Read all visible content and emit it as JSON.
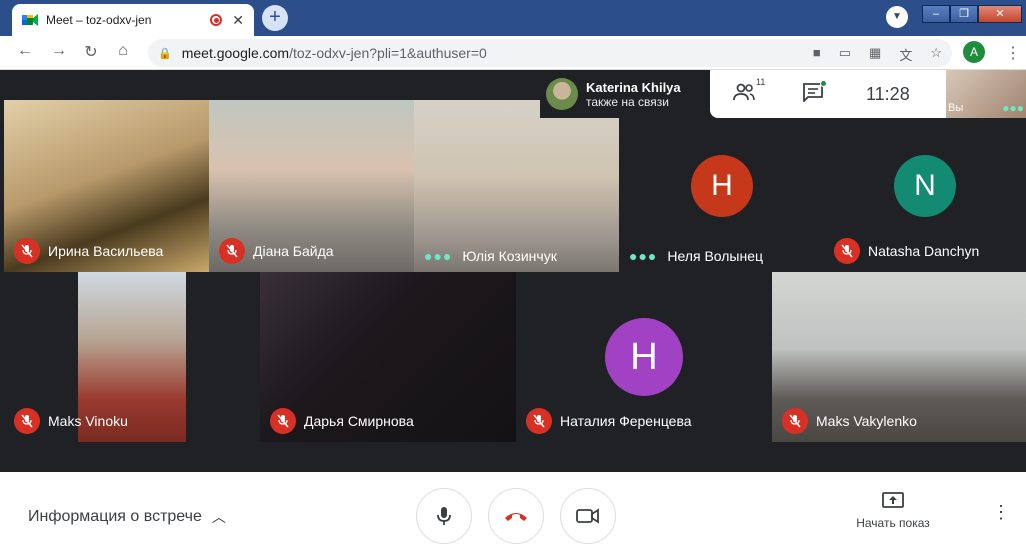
{
  "browser": {
    "tab_title": "Meet – toz-odxv-jen",
    "url_host": "meet.google.com",
    "url_path": "/toz-odxv-jen?pli=1&authuser=0",
    "profile_initial": "A"
  },
  "call_info": {
    "presenter_name": "Katerina Khilya",
    "presenter_status": "также на связи",
    "participants_count": "11",
    "time": "11:28",
    "self_label": "Вы"
  },
  "tiles": [
    {
      "name": "Ирина Васильева",
      "muted": true
    },
    {
      "name": "Діана Байда",
      "muted": true
    },
    {
      "name": "Юлія Козинчук",
      "muted": false
    },
    {
      "name": "Неля Волынец",
      "muted": false,
      "initial": "H",
      "color": "#c5381a"
    },
    {
      "name": "Natasha Danchyn",
      "muted": true,
      "initial": "N",
      "color": "#138a72"
    },
    {
      "name": "Maks Vinoku",
      "muted": true
    },
    {
      "name": "Дарья Смирнова",
      "muted": true
    },
    {
      "name": "Наталия Ференцева",
      "muted": true,
      "initial": "H",
      "color": "#a142c4"
    },
    {
      "name": "Maks Vakylenko",
      "muted": true
    }
  ],
  "bottom": {
    "meeting_details": "Информация о встрече",
    "present_label": "Начать показ"
  },
  "colors": {
    "mic_off": "#d93025",
    "tabstrip": "#2c4f8c",
    "stage": "#202124"
  }
}
